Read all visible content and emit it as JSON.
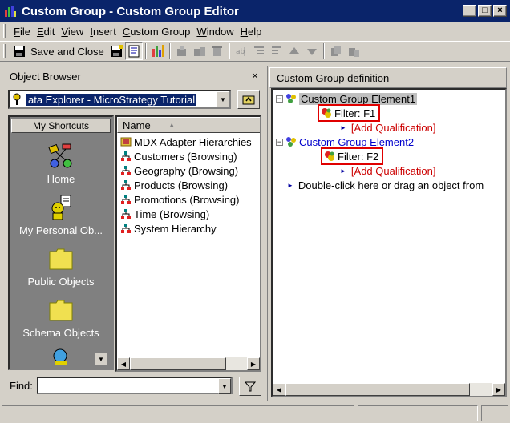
{
  "window": {
    "title": "Custom Group - Custom Group Editor",
    "controls": [
      "_",
      "□",
      "×"
    ]
  },
  "menu": {
    "items": [
      {
        "label": "File",
        "key": "F"
      },
      {
        "label": "Edit",
        "key": "E"
      },
      {
        "label": "View",
        "key": "V"
      },
      {
        "label": "Insert",
        "key": "I"
      },
      {
        "label": "Custom Group",
        "key": "C"
      },
      {
        "label": "Window",
        "key": "W"
      },
      {
        "label": "Help",
        "key": "H"
      }
    ]
  },
  "toolbar": {
    "save_close_label": "Save and Close",
    "icons": [
      "save-close-icon",
      "save-icon",
      "view-toggle-icon",
      "filter-icon",
      "new-element-icon",
      "copy-element-icon",
      "delete-element-icon",
      "rename-icon",
      "indent-icon",
      "outdent-icon",
      "move-up-icon",
      "move-down-icon",
      "cut-icon",
      "paste-icon"
    ]
  },
  "object_browser": {
    "title": "Object Browser",
    "close": "×",
    "location": "ata Explorer - MicroStrategy Tutorial",
    "shortcuts_header": "My Shortcuts",
    "shortcuts": [
      {
        "label": "Home",
        "icon": "home-icon"
      },
      {
        "label": "My Personal Ob...",
        "icon": "personal-objects-icon"
      },
      {
        "label": "Public Objects",
        "icon": "folder-icon"
      },
      {
        "label": "Schema Objects",
        "icon": "folder-icon"
      }
    ],
    "list_header": "Name",
    "list_items": [
      {
        "label": "MDX Adapter Hierarchies",
        "icon": "mdx-folder-icon"
      },
      {
        "label": "Customers (Browsing)",
        "icon": "hierarchy-icon"
      },
      {
        "label": "Geography (Browsing)",
        "icon": "hierarchy-icon"
      },
      {
        "label": "Products (Browsing)",
        "icon": "hierarchy-icon"
      },
      {
        "label": "Promotions (Browsing)",
        "icon": "hierarchy-icon"
      },
      {
        "label": "Time (Browsing)",
        "icon": "hierarchy-icon"
      },
      {
        "label": "System Hierarchy",
        "icon": "hierarchy-icon"
      }
    ],
    "find_label": "Find:",
    "find_value": ""
  },
  "custom_group": {
    "title": "Custom Group definition",
    "elements": [
      {
        "label": "Custom Group Element1",
        "selected": true,
        "filter": "Filter: F1",
        "add_qualification": "[Add Qualification]"
      },
      {
        "label": "Custom Group Element2",
        "selected": false,
        "filter": "Filter: F2",
        "add_qualification": "[Add Qualification]"
      }
    ],
    "hint": "Double-click here or drag an object from"
  },
  "colors": {
    "titlebar": "#0a246a",
    "highlight_box": "#e00000",
    "link_blue": "#0000cc",
    "qual_red": "#cc0000"
  }
}
